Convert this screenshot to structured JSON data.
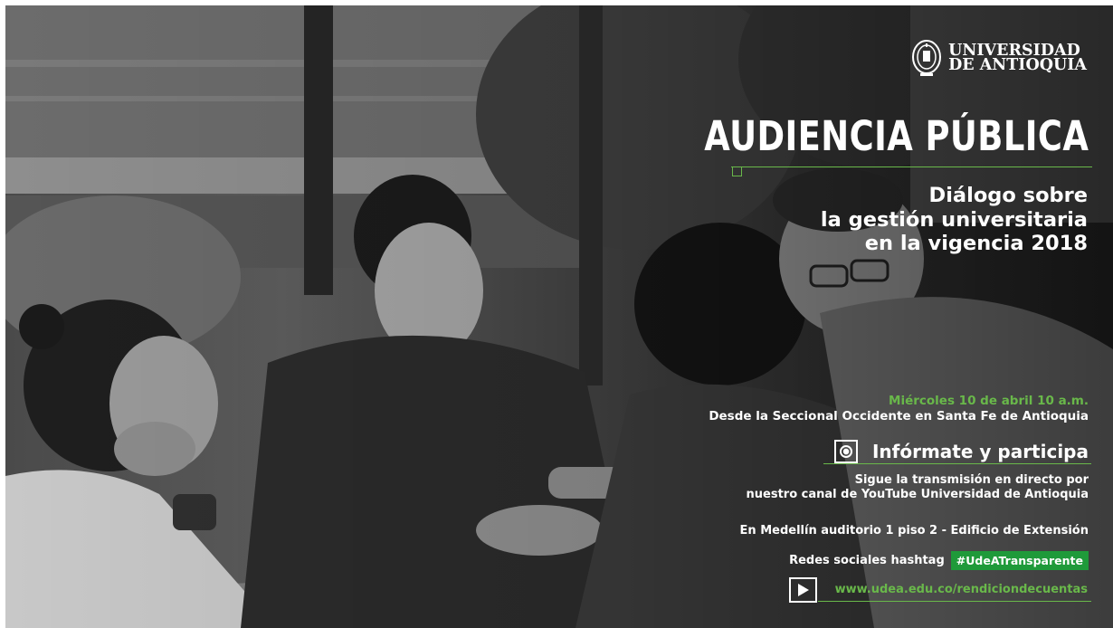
{
  "logo": {
    "line1": "UNIVERSIDAD",
    "line2": "DE ANTIOQUIA"
  },
  "title": "AUDIENCIA PÚBLICA",
  "subtitle": {
    "line1": "Diálogo sobre",
    "line2": "la gestión universitaria",
    "line3": "en la vigencia 2018"
  },
  "event": {
    "date": "Miércoles 10 de abril 10 a.m.",
    "place": "Desde la Seccional Occidente en Santa Fe de Antioquia"
  },
  "info": {
    "heading": "Infórmate y participa",
    "follow_line1": "Sigue la transmisión en directo por",
    "follow_line2": "nuestro canal de YouTube Universidad de Antioquia",
    "venue": "En Medellín auditorio 1 piso 2 - Edificio de Extensión"
  },
  "social": {
    "label": "Redes sociales hashtag",
    "hashtag": "#UdeATransparente"
  },
  "website": "www.udea.edu.co/rendiciondecuentas",
  "colors": {
    "accent_green": "#69b84a",
    "badge_green": "#1f9a3a"
  }
}
